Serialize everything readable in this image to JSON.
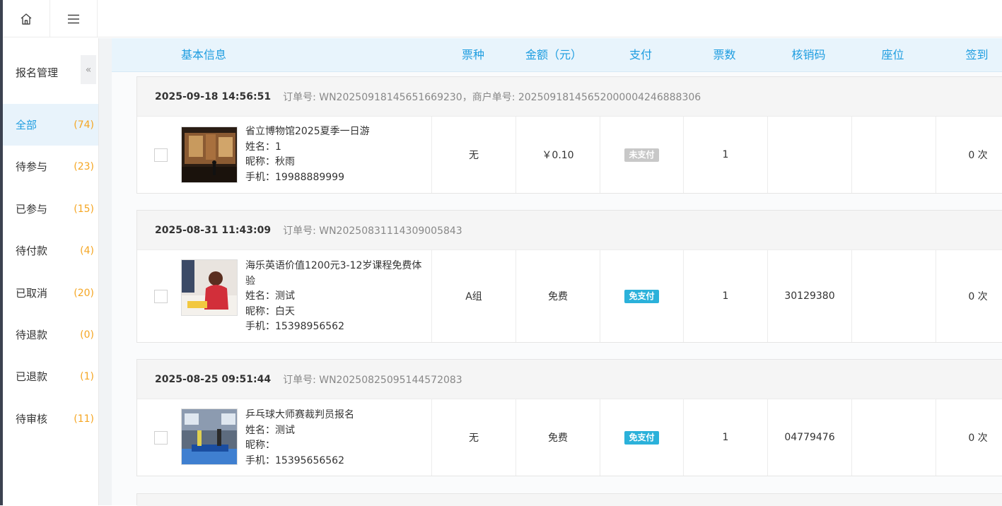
{
  "sidebar": {
    "title": "报名管理",
    "collapse_icon": "«",
    "items": [
      {
        "label": "全部",
        "count": "(74)"
      },
      {
        "label": "待参与",
        "count": "(23)"
      },
      {
        "label": "已参与",
        "count": "(15)"
      },
      {
        "label": "待付款",
        "count": "(4)"
      },
      {
        "label": "已取消",
        "count": "(20)"
      },
      {
        "label": "待退款",
        "count": "(0)"
      },
      {
        "label": "已退款",
        "count": "(1)"
      },
      {
        "label": "待审核",
        "count": "(11)"
      }
    ]
  },
  "table": {
    "headers": {
      "basic": "基本信息",
      "ticket_type": "票种",
      "amount": "金额（元）",
      "payment": "支付",
      "quantity": "票数",
      "code": "核销码",
      "seat": "座位",
      "checkin": "签到"
    }
  },
  "orders": [
    {
      "time": "2025-09-18 14:56:51",
      "order_no": "订单号: WN20250918145651669230，商户单号: 20250918145652000004246888306",
      "title": "省立博物馆2025夏季一日游",
      "name": "姓名：1",
      "nickname": "昵称：秋雨",
      "phone": "手机：19988889999",
      "ticket_type": "无",
      "amount": "￥0.10",
      "payment": "未支付",
      "quantity": "1",
      "code": "",
      "seat": "",
      "checkin": "0 次"
    },
    {
      "time": "2025-08-31 11:43:09",
      "order_no": "订单号: WN20250831114309005843",
      "title": "海乐英语价值1200元3-12岁课程免费体验",
      "name": "姓名：测试",
      "nickname": "昵称：白天",
      "phone": "手机：15398956562",
      "ticket_type": "A组",
      "amount": "免费",
      "payment": "免支付",
      "quantity": "1",
      "code": "30129380",
      "seat": "",
      "checkin": "0 次"
    },
    {
      "time": "2025-08-25 09:51:44",
      "order_no": "订单号: WN20250825095144572083",
      "title": "乒乓球大师赛裁判员报名",
      "name": "姓名：测试",
      "nickname": "昵称：",
      "phone": "手机：15395656562",
      "ticket_type": "无",
      "amount": "免费",
      "payment": "免支付",
      "quantity": "1",
      "code": "04779476",
      "seat": "",
      "checkin": "0 次"
    }
  ],
  "colors": {
    "accent": "#1e9de0",
    "count": "#f5a623",
    "unpaid_badge": "#c8c8c8",
    "free_badge": "#2bb1da"
  }
}
